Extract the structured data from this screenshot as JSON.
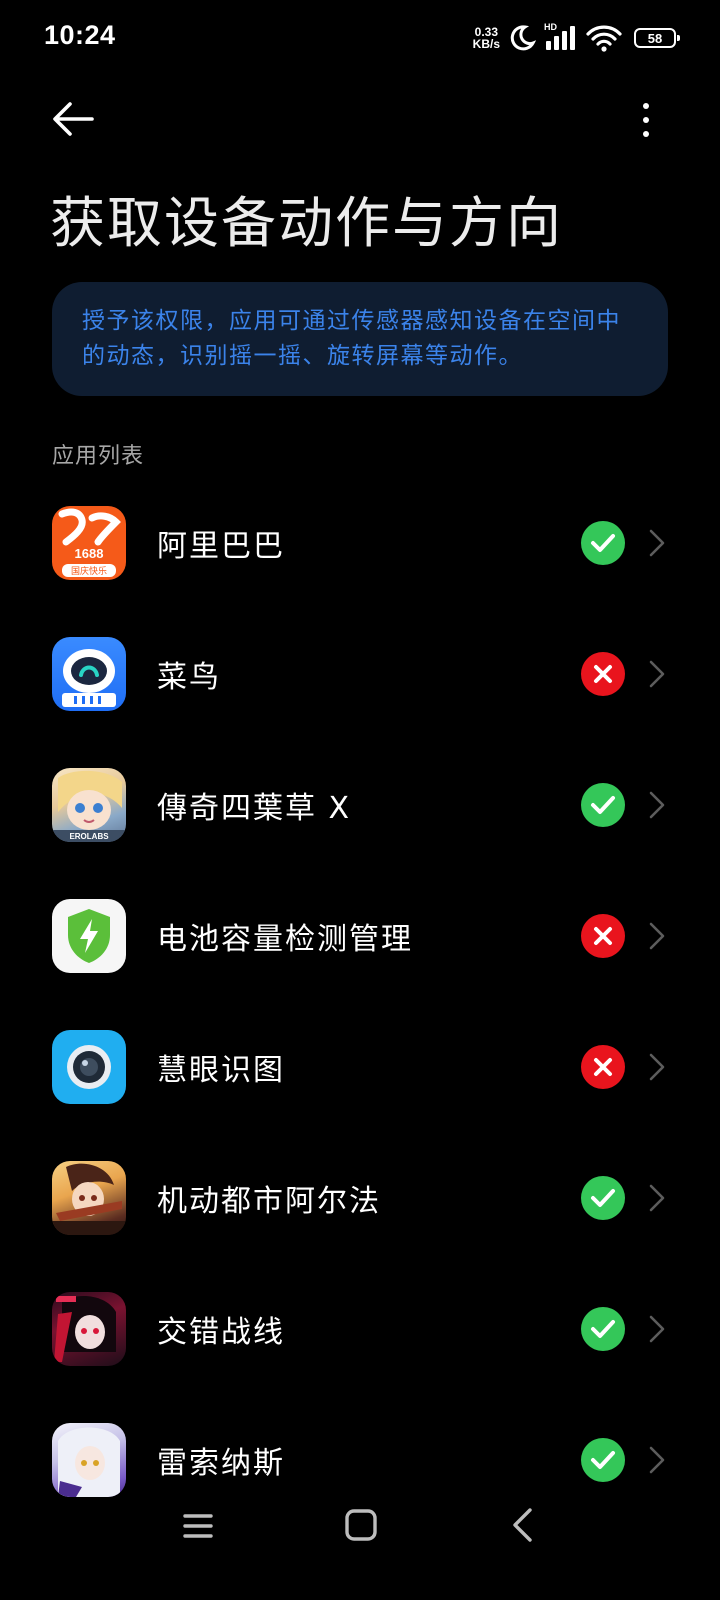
{
  "status_bar": {
    "time": "10:24",
    "net_speed_value": "0.33",
    "net_speed_unit": "KB/s",
    "signal_label": "HD",
    "battery_level": "58"
  },
  "header": {
    "title": "获取设备动作与方向"
  },
  "info_banner": {
    "text": "授予该权限，应用可通过传感器感知设备在空间中的动态，识别摇一摇、旋转屏幕等动作。"
  },
  "section_label": "应用列表",
  "apps": [
    {
      "name": "阿里巴巴",
      "allowed": true,
      "icon": "alibaba-1688-icon"
    },
    {
      "name": "菜鸟",
      "allowed": false,
      "icon": "cainiao-robot-icon"
    },
    {
      "name": "傳奇四葉草 X",
      "allowed": true,
      "icon": "last-origin-anime-icon"
    },
    {
      "name": "电池容量检测管理",
      "allowed": false,
      "icon": "battery-shield-icon"
    },
    {
      "name": "慧眼识图",
      "allowed": false,
      "icon": "camera-lens-icon"
    },
    {
      "name": "机动都市阿尔法",
      "allowed": true,
      "icon": "anime-soldier-icon"
    },
    {
      "name": "交错战线",
      "allowed": true,
      "icon": "anime-girl-red-icon"
    },
    {
      "name": "雷索纳斯",
      "allowed": true,
      "icon": "anime-white-hair-icon"
    }
  ],
  "app_icon_text": {
    "alibaba_number": "1688",
    "alibaba_caption": "国庆快乐",
    "lastorigin_caption": "EROLABS"
  },
  "colors": {
    "allowed_green": "#34c759",
    "denied_red": "#e9141d",
    "banner_bg": "#0f1d31",
    "banner_text": "#3b83ea",
    "background": "#000000"
  }
}
